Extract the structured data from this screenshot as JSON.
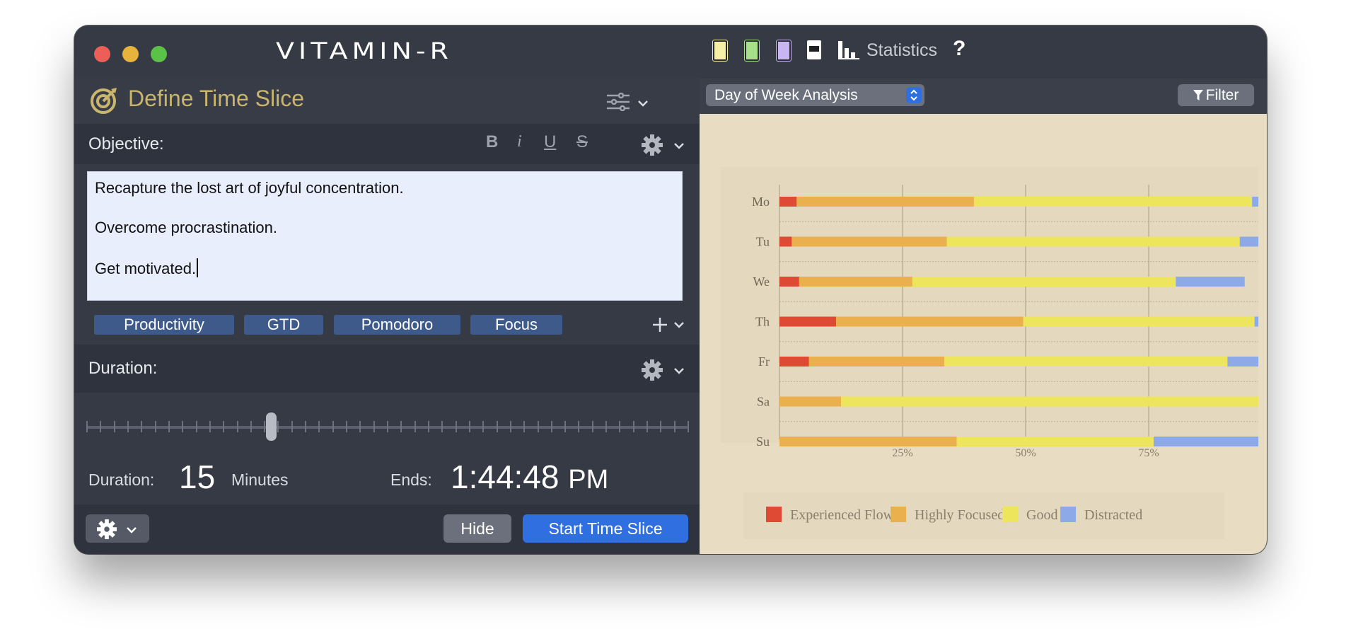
{
  "app": {
    "logo": "VITAMIN-R"
  },
  "define": {
    "title": "Define Time Slice"
  },
  "objective": {
    "label": "Objective:",
    "format": {
      "bold": "B",
      "italic": "i",
      "underline": "U",
      "strike": "S"
    },
    "lines": [
      "Recapture the lost art of joyful concentration.",
      "Overcome procrastination.",
      "Get motivated."
    ]
  },
  "tags": [
    "Productivity",
    "GTD",
    "Pomodoro",
    "Focus"
  ],
  "duration": {
    "label": "Duration:",
    "value_label": "Duration:",
    "value": "15",
    "unit": "Minutes",
    "ends_label": "Ends:",
    "ends_time": "1:44:48",
    "ends_ampm": "PM",
    "slider_fraction": 0.31
  },
  "buttons": {
    "hide": "Hide",
    "start": "Start Time Slice"
  },
  "right": {
    "statistics_label": "Statistics",
    "help": "?",
    "analysis_select": "Day of Week Analysis",
    "filter_label": "Filter"
  },
  "chart_data": {
    "type": "bar",
    "orientation": "horizontal",
    "stacked": true,
    "categories": [
      "Mo",
      "Tu",
      "We",
      "Th",
      "Fr",
      "Sa",
      "Su"
    ],
    "series": [
      {
        "name": "Experienced Flow",
        "color": "#de4a33",
        "values": [
          3.5,
          2.5,
          4,
          11.5,
          6,
          0,
          0
        ]
      },
      {
        "name": "Highly Focused",
        "color": "#ebb04e",
        "values": [
          36,
          31.5,
          23,
          38,
          27.5,
          12.5,
          36
        ]
      },
      {
        "name": "Good",
        "color": "#ede65d",
        "values": [
          56.5,
          59.5,
          53.5,
          47,
          57.5,
          87.5,
          40
        ]
      },
      {
        "name": "Distracted",
        "color": "#8ea9e8",
        "values": [
          4,
          6.5,
          14,
          3.5,
          9,
          0,
          24
        ]
      }
    ],
    "xticks": [
      "25%",
      "50%",
      "75%"
    ],
    "xlim": [
      0,
      100
    ],
    "grid": true,
    "legend": "bottom"
  }
}
